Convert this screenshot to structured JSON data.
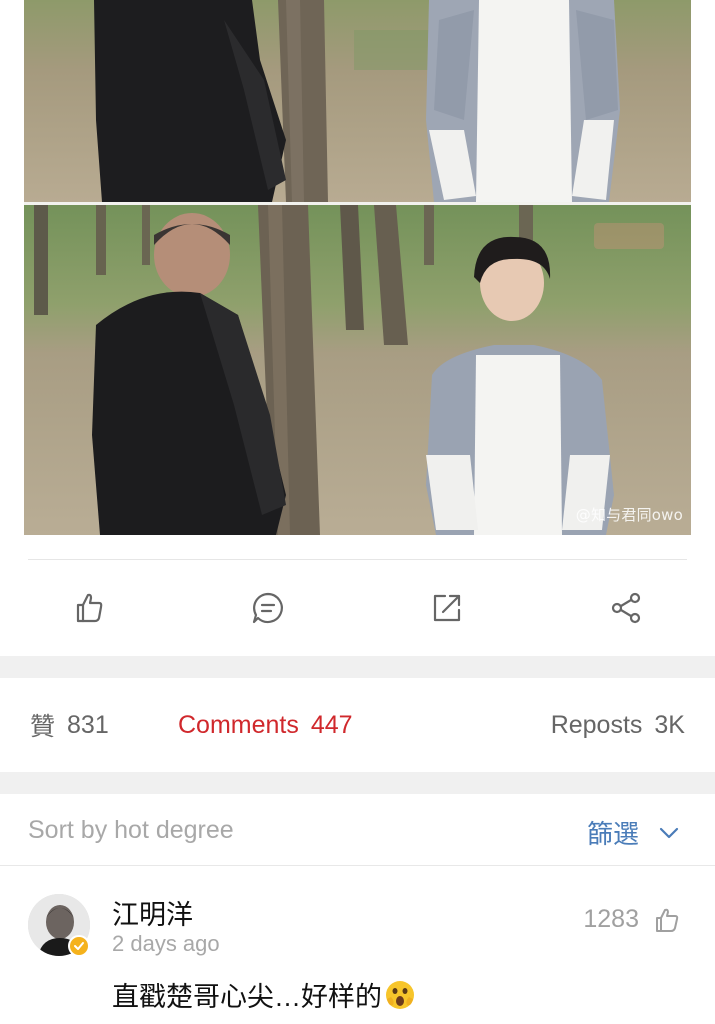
{
  "post": {
    "watermark": "@知与君同owo"
  },
  "actions": [
    {
      "icon": "thumbs-up-icon"
    },
    {
      "icon": "comment-icon"
    },
    {
      "icon": "repost-icon"
    },
    {
      "icon": "share-icon"
    }
  ],
  "stats": {
    "like_label": "贊",
    "like_count": "831",
    "comments_label": "Comments",
    "comments_count": "447",
    "reposts_label": "Reposts",
    "reposts_count": "3K"
  },
  "sort": {
    "label": "Sort by hot degree",
    "filter_label": "篩選",
    "filter_icon": "chevron-down-icon"
  },
  "comment": {
    "username": "江明洋",
    "timestamp": "2 days ago",
    "likes": "1283",
    "text": "直戳楚哥心尖…好样的",
    "emoji": "shocked-face-emoji",
    "verified": true
  },
  "colors": {
    "accent_red": "#d0282c",
    "link_blue": "#4a7cb8",
    "verified_gold": "#f5b21c",
    "muted_text": "#a8a8a8",
    "separator": "#f0f0f0"
  }
}
